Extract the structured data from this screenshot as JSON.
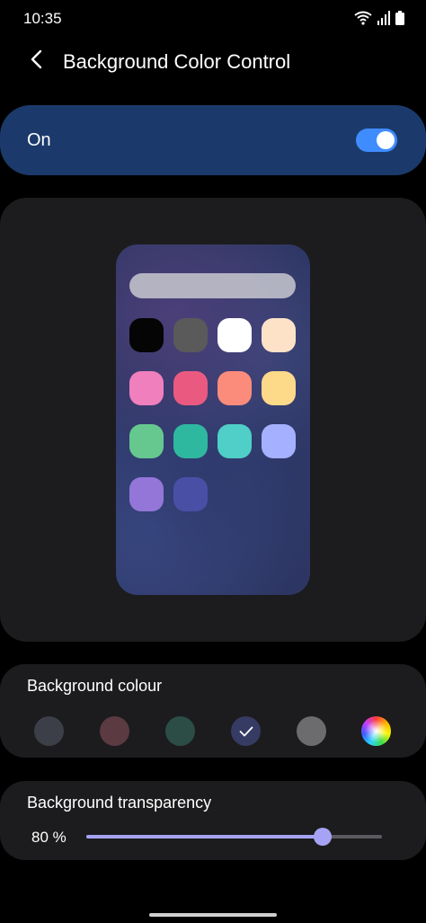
{
  "status_bar": {
    "time": "10:35",
    "icons": [
      "wifi-icon",
      "signal-icon",
      "battery-icon"
    ]
  },
  "header": {
    "back_icon": "chevron-left-icon",
    "title": "Background Color Control"
  },
  "master_switch": {
    "label": "On",
    "enabled": true,
    "accent": "#3f8cff"
  },
  "preview": {
    "app_icon_colors": [
      "#050505",
      "#5a5a5a",
      "#ffffff",
      "#fde2c8",
      "#f07fbd",
      "#ea5a80",
      "#fb8c7c",
      "#fdd98a",
      "#66c88f",
      "#2fb8a0",
      "#4fcfc7",
      "#a5b1ff",
      "#9476d8",
      "#4a4fa6"
    ]
  },
  "background_colour": {
    "label": "Background colour",
    "swatches": [
      {
        "name": "swatch-dark-gray",
        "color": "#3c3f48",
        "selected": false
      },
      {
        "name": "swatch-maroon",
        "color": "#5b3a42",
        "selected": false
      },
      {
        "name": "swatch-dark-green",
        "color": "#2b4d46",
        "selected": false
      },
      {
        "name": "swatch-navy",
        "color": "#363b63",
        "selected": true
      },
      {
        "name": "swatch-gray",
        "color": "#6c6c6e",
        "selected": false
      },
      {
        "name": "swatch-custom-rainbow",
        "color": "rainbow",
        "selected": false
      }
    ]
  },
  "background_transparency": {
    "label": "Background transparency",
    "value_text": "80 %",
    "value": 0.8,
    "accent": "#a6a3f5"
  }
}
